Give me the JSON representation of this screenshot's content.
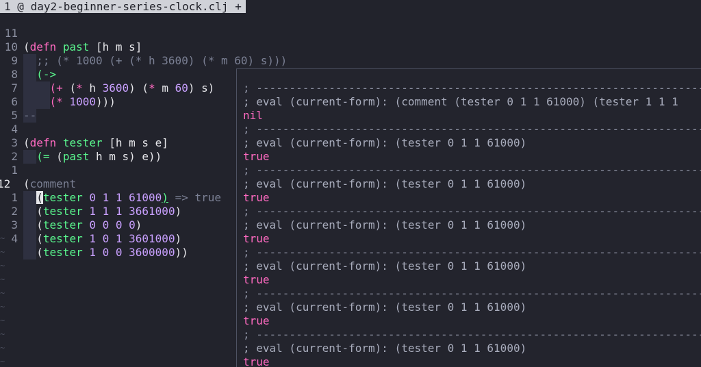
{
  "tab": {
    "number": "1",
    "icon": "@",
    "filename": "day2-beginner-series-clock.clj",
    "modified": "+"
  },
  "gutter": [
    "11",
    "10",
    "9",
    "8",
    "7",
    "6",
    "5",
    "4",
    "3",
    "2",
    "1",
    "12",
    "1",
    "2",
    "3",
    "4"
  ],
  "code": {
    "l1_a": "(",
    "l1_kw": "defn",
    "l1_fn": "past",
    "l1_rest": " [h m s]",
    "l2": ";; (* 1000 (+ (* h 3600) (* m 60) s)))",
    "l3_a": "(",
    "l3_op": "->",
    "l4_a": "(",
    "l4_plus": "+",
    "l4_b": " (",
    "l4_star": "*",
    "l4_c": " h ",
    "l4_n1": "3600",
    "l4_d": ") (",
    "l4_star2": "*",
    "l4_e": " m ",
    "l4_n2": "60",
    "l4_f": ") s)",
    "l5_a": "(",
    "l5_star": "*",
    "l5_b": " ",
    "l5_n": "1000",
    "l5_c": ")))",
    "l6": "--",
    "l8_a": "(",
    "l8_kw": "defn",
    "l8_fn": "tester",
    "l8_rest": " [h m s e]",
    "l9_a": "(",
    "l9_eq": "=",
    "l9_b": " (",
    "l9_fn": "past",
    "l9_c": " h m s) e))",
    "l11_a": "(",
    "l11_cmt": "comment",
    "l12_cur": "(",
    "l12_fn": "tester",
    "l12_n": "0 1 1 61000",
    "l12_close": ")",
    "l12_vt": " => true",
    "l13_fn": "tester",
    "l13_n": "1 1 1 3661000",
    "l14_fn": "tester",
    "l14_n": "0 0 0 0",
    "l15_fn": "tester",
    "l15_n": "1 0 1 3601000",
    "l16_fn": "tester",
    "l16_n": "1 0 0 3600000",
    "l16_close": "))"
  },
  "eval_window": {
    "separator": "; ------------------------------------------------------------------------",
    "entries": [
      {
        "form": "; eval (current-form): (comment (tester 0 1 1 61000) (tester 1 1 1",
        "result": "nil"
      },
      {
        "form": "; eval (current-form): (tester 0 1 1 61000)",
        "result": "true"
      },
      {
        "form": "; eval (current-form): (tester 0 1 1 61000)",
        "result": "true"
      },
      {
        "form": "; eval (current-form): (tester 0 1 1 61000)",
        "result": "true"
      },
      {
        "form": "; eval (current-form): (tester 0 1 1 61000)",
        "result": "true"
      },
      {
        "form": "; eval (current-form): (tester 0 1 1 61000)",
        "result": "true"
      },
      {
        "form": "; eval (current-form): (tester 0 1 1 61000)",
        "result": "true"
      }
    ]
  },
  "tilde": "~",
  "colors": {
    "keyword": "#ff6ac1",
    "function": "#5af78e",
    "number": "#c9a0ff",
    "comment": "#7b8094",
    "background": "#22232c"
  }
}
